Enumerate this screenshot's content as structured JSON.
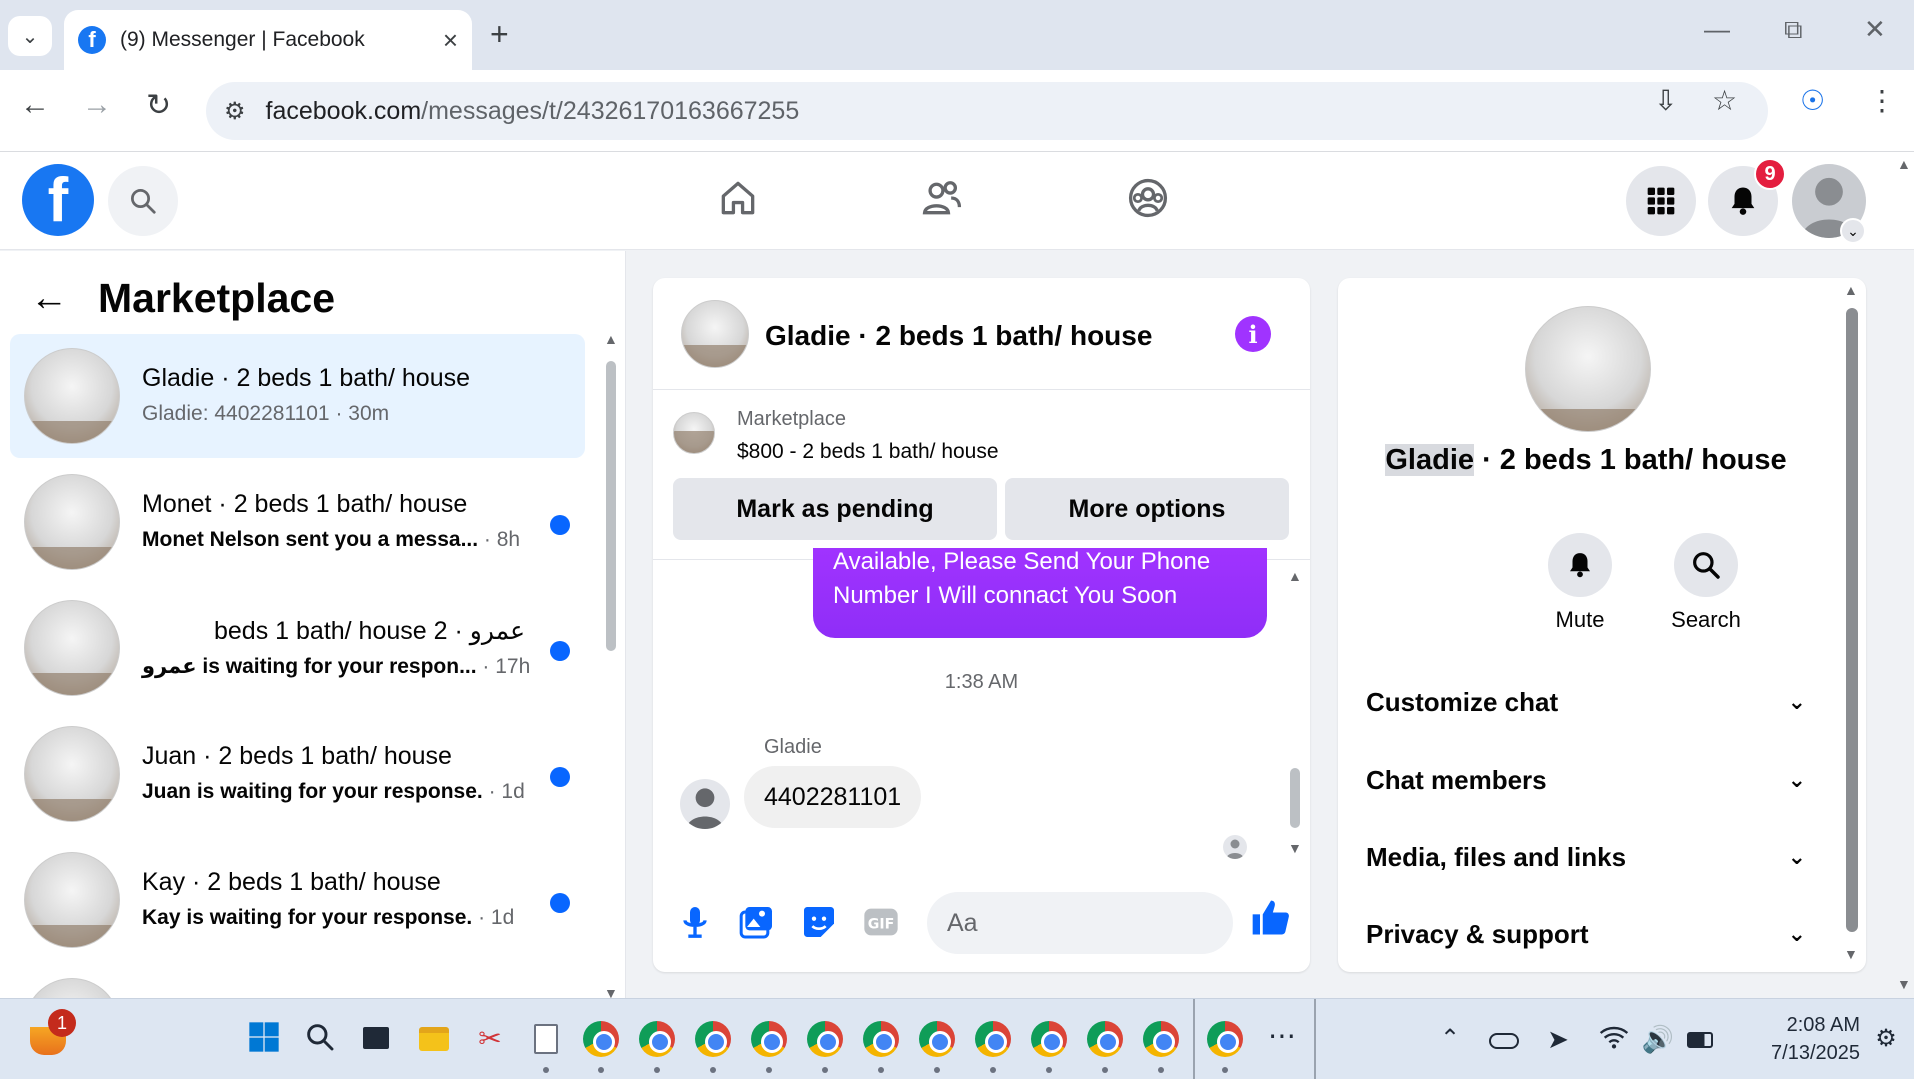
{
  "browser": {
    "tab_title": "(9) Messenger | Facebook",
    "url_host": "facebook.com",
    "url_path": "/messages/t/24326170163667255"
  },
  "fb": {
    "notification_count": "9"
  },
  "left_panel": {
    "title": "Marketplace",
    "conversations": [
      {
        "name": "Gladie · 2 beds 1 bath/ house",
        "snippet": "Gladie: 4402281101",
        "time": " · 30m",
        "unread": false
      },
      {
        "name": "Monet · 2 beds 1 bath/ house",
        "snippet": "Monet Nelson sent you a messa...",
        "time": " · 8h",
        "unread": true
      },
      {
        "name": "عمرو · 2 beds 1 bath/ house",
        "snippet": "عمرو is waiting for your respon...",
        "time": " · 17h",
        "unread": true
      },
      {
        "name": "Juan · 2 beds 1 bath/ house",
        "snippet": "Juan is waiting for your response.",
        "time": " · 1d",
        "unread": true
      },
      {
        "name": "Kay · 2 beds 1 bath/ house",
        "snippet": "Kay is waiting for your response.",
        "time": " · 1d",
        "unread": true
      }
    ]
  },
  "chat": {
    "title": "Gladie · 2 beds 1 bath/ house",
    "listing_label": "Marketplace",
    "listing_price": "$800 - 2 beds 1 bath/ house",
    "mark_pending": "Mark as pending",
    "more_options": "More options",
    "outgoing_line1": "Available, Please Send Your Phone",
    "outgoing_line2": "Number I Will connact You Soon",
    "timestamp": "1:38 AM",
    "sender": "Gladie",
    "incoming": "4402281101",
    "input_placeholder": "Aa"
  },
  "details": {
    "name_highlight": "Gladie",
    "name_rest": " · 2 beds 1 bath/ house",
    "mute_label": "Mute",
    "search_label": "Search",
    "sections": [
      "Customize chat",
      "Chat members",
      "Media, files and links",
      "Privacy & support"
    ]
  },
  "taskbar": {
    "time": "2:08 AM",
    "date": "7/13/2025",
    "weather_badge": "1"
  },
  "colors": {
    "fb_blue": "#1877f2",
    "messenger_purple": "#a033ff",
    "unread_dot": "#0866ff",
    "badge_red": "#e41e3f"
  }
}
